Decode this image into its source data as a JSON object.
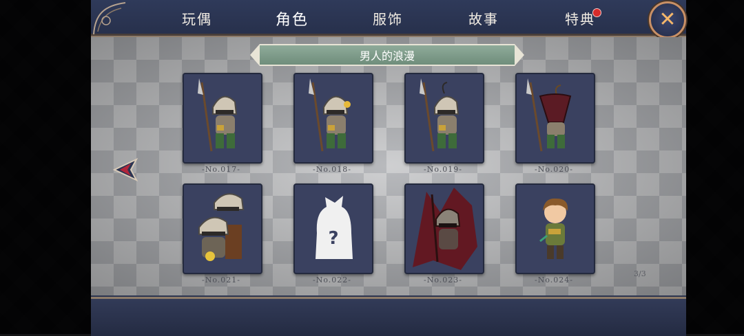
{
  "tabs": [
    {
      "label": "玩偶"
    },
    {
      "label": "角色"
    },
    {
      "label": "服饰"
    },
    {
      "label": "故事"
    },
    {
      "label": "特典"
    }
  ],
  "active_tab": "角色",
  "close_label": "✕",
  "collection_title": "男人的浪漫",
  "cards": [
    {
      "number": "-No.017-",
      "character": "knight-spear-icon"
    },
    {
      "number": "-No.018-",
      "character": "knight-spear-flower-icon"
    },
    {
      "number": "-No.019-",
      "character": "knight-spear-sprout-icon"
    },
    {
      "number": "-No.020-",
      "character": "knight-pot-helmet-icon"
    },
    {
      "number": "-No.021-",
      "character": "knight-duo-icon"
    },
    {
      "number": "-No.022-",
      "character": "locked-silhouette-icon"
    },
    {
      "number": "-No.023-",
      "character": "knight-cursed-icon"
    },
    {
      "number": "-No.024-",
      "character": "villager-boy-icon"
    }
  ],
  "locked_mark": "?",
  "page_indicator": "3/3",
  "colors": {
    "accent_red": "#d72b2b",
    "banner_green": "#7f9c8a",
    "card_bg": "#3a4160",
    "close_gold": "#f5b76b"
  }
}
